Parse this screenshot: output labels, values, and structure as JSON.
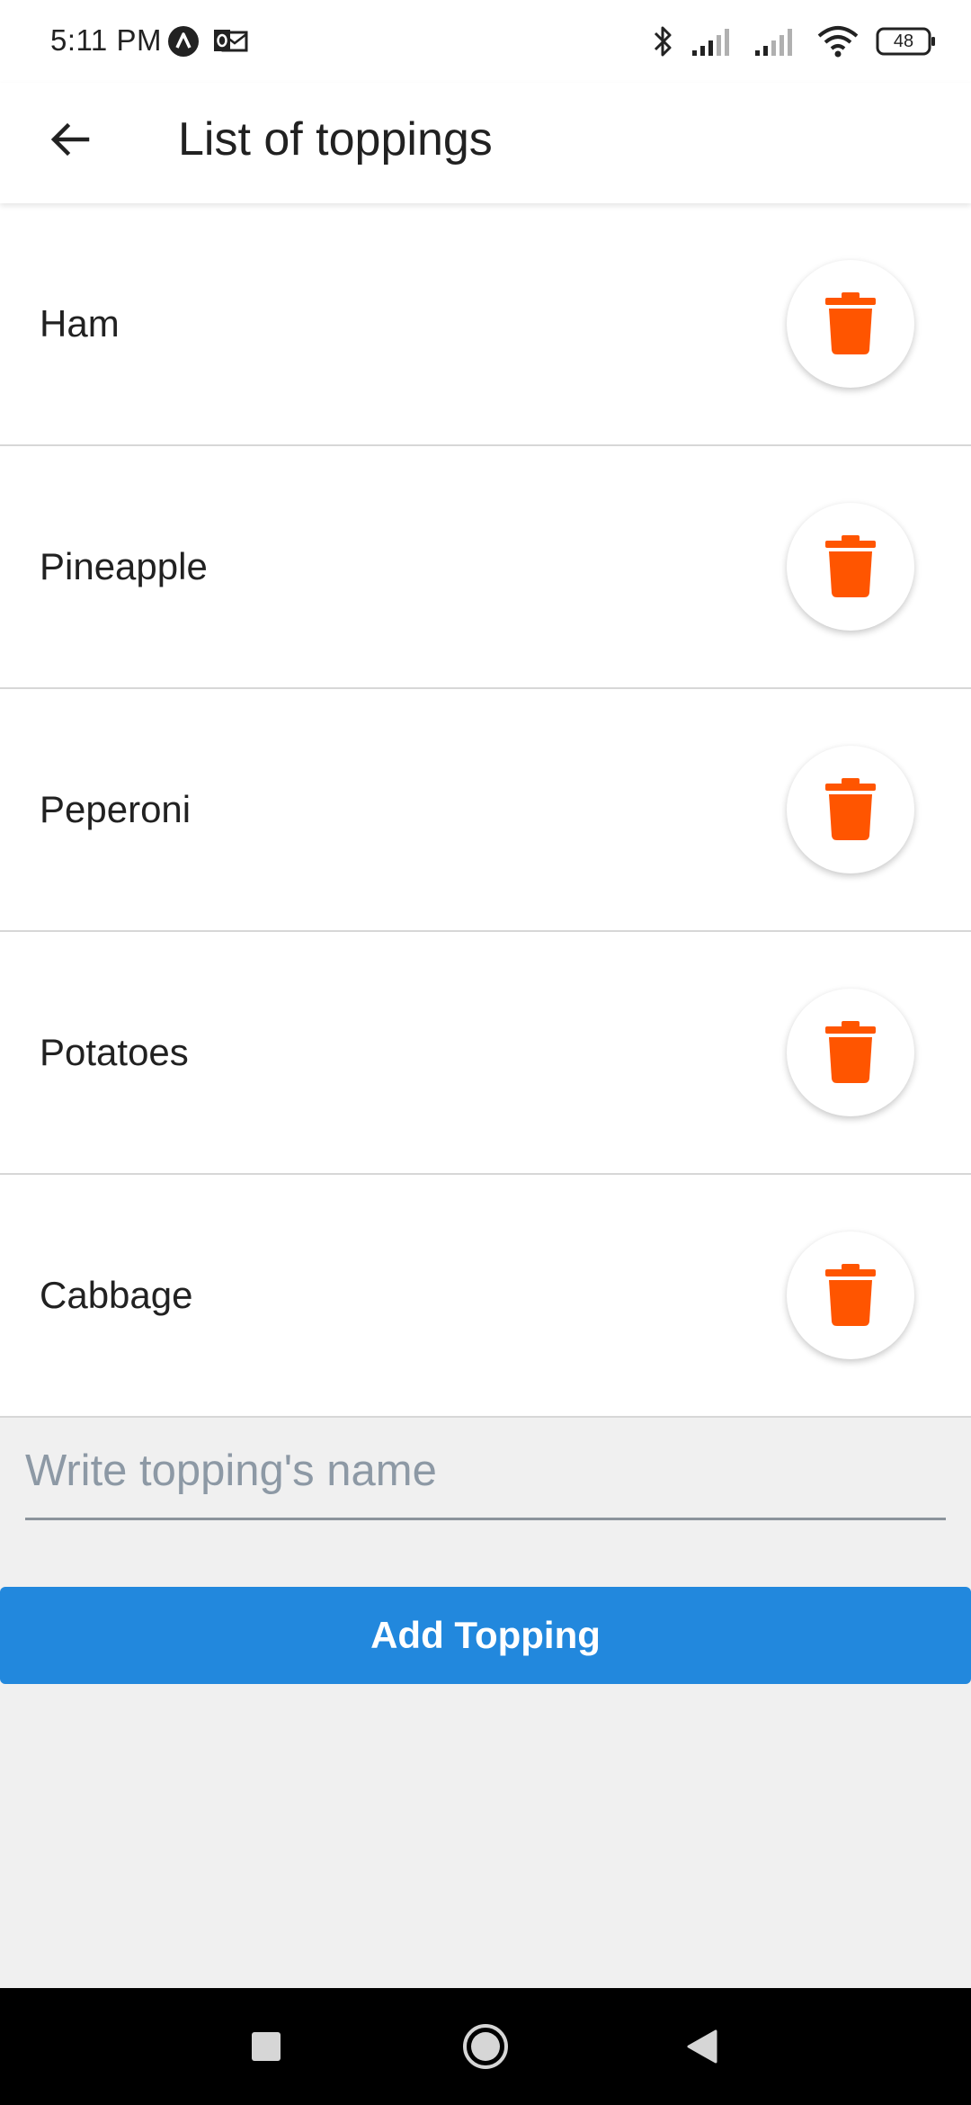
{
  "status_bar": {
    "time": "5:11 PM",
    "battery": "48",
    "icons": [
      "app-a-icon",
      "outlook-icon",
      "bluetooth-icon",
      "signal-icon",
      "signal-icon",
      "wifi-icon",
      "battery-icon"
    ]
  },
  "app_bar": {
    "title": "List of toppings",
    "back_icon": "arrow-back-icon"
  },
  "toppings": [
    {
      "name": "Ham"
    },
    {
      "name": "Pineapple"
    },
    {
      "name": "Peperoni"
    },
    {
      "name": "Potatoes"
    },
    {
      "name": "Cabbage"
    }
  ],
  "input": {
    "value": "",
    "placeholder": "Write topping's name"
  },
  "add_button": {
    "label": "Add Topping"
  },
  "nav_bar": {
    "icons": [
      "recents-square-icon",
      "home-circle-icon",
      "back-triangle-icon"
    ]
  },
  "colors": {
    "accent": "#2288dd",
    "delete_icon": "#ff5500",
    "background": "#f0f0f0",
    "divider": "#d7d7d7"
  }
}
